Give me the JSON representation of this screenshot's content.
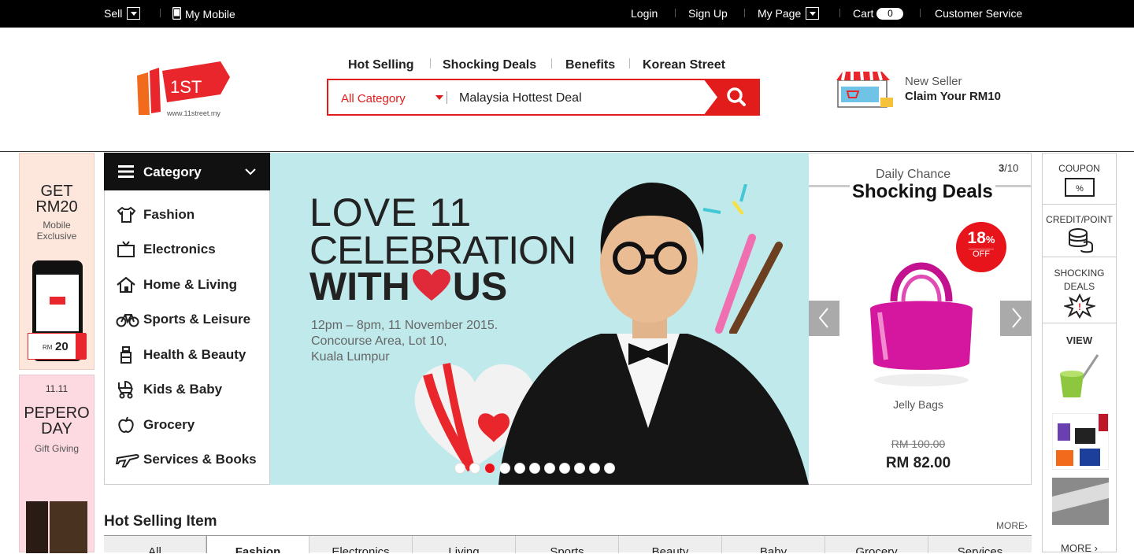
{
  "topbar": {
    "sell": "Sell",
    "my_mobile": "My Mobile",
    "login": "Login",
    "signup": "Sign Up",
    "mypage": "My Page",
    "cart": "Cart",
    "cart_count": "0",
    "customer_service": "Customer Service"
  },
  "logo": {
    "text": "1ST",
    "url_text": "www.11street.my"
  },
  "header_nav": [
    "Hot Selling",
    "Shocking Deals",
    "Benefits",
    "Korean Street"
  ],
  "search": {
    "category": "All Category",
    "value": "Malaysia Hottest Deal"
  },
  "seller_promo": {
    "line1": "New Seller",
    "line2": "Claim Your RM10"
  },
  "left_promo1": {
    "title1": "GET",
    "title2": "RM20",
    "sub1": "Mobile",
    "sub2": "Exclusive",
    "amount": "20",
    "currency": "RM"
  },
  "left_promo2": {
    "date": "11.11",
    "title1": "PEPERO",
    "title2": "DAY",
    "sub": "Gift Giving"
  },
  "category": {
    "title": "Category",
    "items": [
      {
        "label": "Fashion",
        "icon": "shirt-icon"
      },
      {
        "label": "Electronics",
        "icon": "tv-icon"
      },
      {
        "label": "Home & Living",
        "icon": "house-icon"
      },
      {
        "label": "Sports & Leisure",
        "icon": "bicycle-icon"
      },
      {
        "label": "Health & Beauty",
        "icon": "bottle-icon"
      },
      {
        "label": "Kids & Baby",
        "icon": "stroller-icon"
      },
      {
        "label": "Grocery",
        "icon": "apple-icon"
      },
      {
        "label": "Services & Books",
        "icon": "plane-icon"
      }
    ]
  },
  "banner": {
    "line1": "LOVE 11",
    "line2": "CELEBRATION",
    "line3a": "WITH",
    "line3b": "US",
    "details": [
      "12pm – 8pm, 11 November 2015.",
      "Concourse Area, Lot 10,",
      "Kuala Lumpur"
    ],
    "active_slide": 3,
    "slide_count": 11
  },
  "deal": {
    "subtitle": "Daily Chance",
    "title": "Shocking Deals",
    "page": "3",
    "total": "10",
    "discount": "18",
    "discount_unit": "%",
    "discount_label": "OFF",
    "product": "Jelly Bags",
    "old_price": "RM 100.00",
    "price": "RM 82.00",
    "colors": {
      "accent": "#e21b1b",
      "bag": "#d4179e"
    }
  },
  "rail": {
    "coupon": "COUPON",
    "credit": "CREDIT/POINT",
    "shocking1": "SHOCKING",
    "shocking2": "DEALS",
    "view": "VIEW",
    "more": "MORE"
  },
  "hot_selling": {
    "title": "Hot Selling Item",
    "more": "MORE",
    "tabs": [
      "All",
      "Fashion",
      "Electronics",
      "Living",
      "Sports",
      "Beauty",
      "Baby",
      "Grocery",
      "Services"
    ]
  }
}
